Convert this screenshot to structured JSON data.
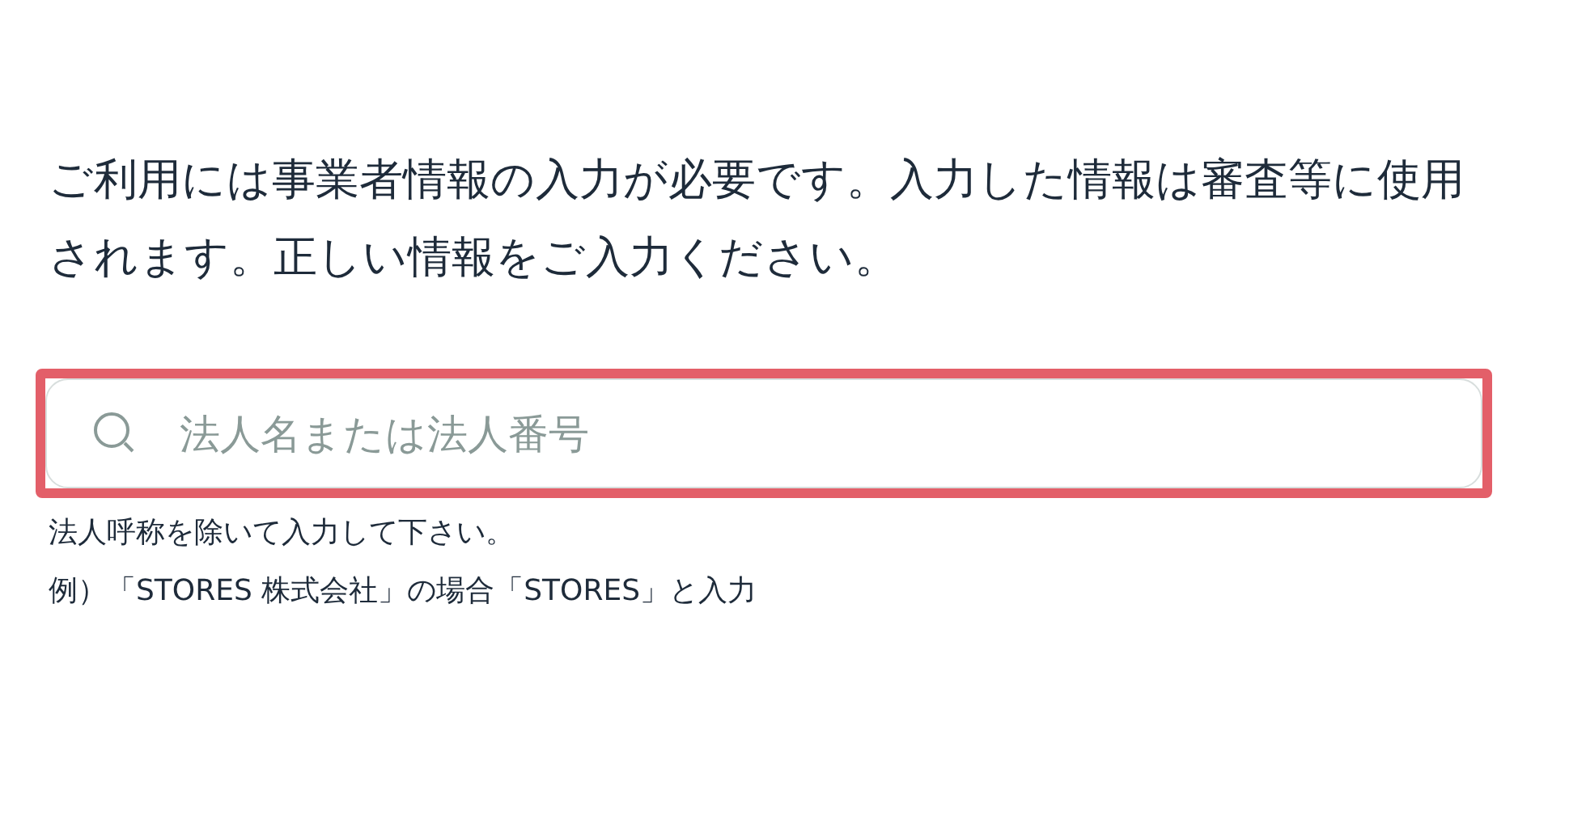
{
  "intro": "ご利用には事業者情報の入力が必要です。入力した情報は審査等に使用されます。正しい情報をご入力ください。",
  "search": {
    "placeholder": "法人名または法人番号",
    "highlighted": true
  },
  "hints": [
    "法人呼称を除いて入力して下さい。",
    "例）「STORES 株式会社」の場合「STORES」と入力"
  ]
}
